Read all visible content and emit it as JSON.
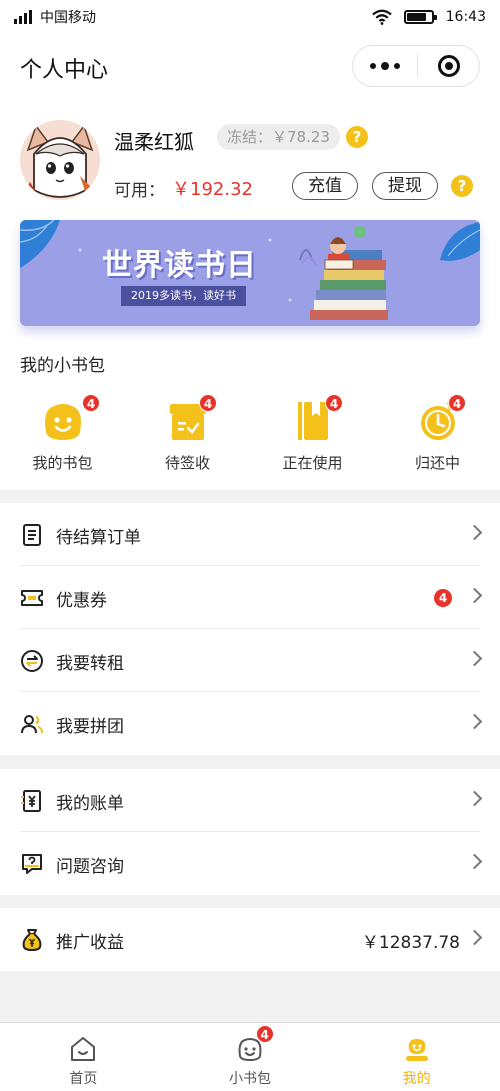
{
  "status_bar": {
    "carrier": "中国移动",
    "time": "16:43"
  },
  "nav": {
    "title": "个人中心"
  },
  "profile": {
    "username": "温柔红狐",
    "frozen": "冻结：￥78.23",
    "available_label": "可用：",
    "available_value": "￥192.32",
    "recharge_label": "充值",
    "withdraw_label": "提现",
    "help_glyph": "?"
  },
  "banner": {
    "title": "世界读书日",
    "subtitle": "2019多读书，读好书"
  },
  "bookbag": {
    "title": "我的小书包",
    "items": [
      {
        "label": "我的书包",
        "badge": "4",
        "icon": "smiley-bag-icon"
      },
      {
        "label": "待签收",
        "badge": "4",
        "icon": "package-icon"
      },
      {
        "label": "正在使用",
        "badge": "4",
        "icon": "book-bookmark-icon"
      },
      {
        "label": "归还中",
        "badge": "4",
        "icon": "clock-return-icon"
      }
    ]
  },
  "menu_group_1": [
    {
      "label": "待结算订单",
      "icon": "order-list-icon"
    },
    {
      "label": "优惠券",
      "icon": "coupon-icon",
      "badge": "4"
    },
    {
      "label": "我要转租",
      "icon": "transfer-icon"
    },
    {
      "label": "我要拼团",
      "icon": "group-users-icon"
    }
  ],
  "menu_group_2": [
    {
      "label": "我的账单",
      "icon": "bill-icon"
    },
    {
      "label": "问题咨询",
      "icon": "question-chat-icon"
    }
  ],
  "menu_group_3": [
    {
      "label": "推广收益",
      "icon": "money-bag-icon",
      "value": "￥12837.78"
    }
  ],
  "tab_bar": [
    {
      "label": "首页",
      "icon": "home-icon",
      "active": false
    },
    {
      "label": "小书包",
      "icon": "bookbag-tab-icon",
      "badge": "4",
      "active": false
    },
    {
      "label": "我的",
      "icon": "profile-tab-icon",
      "active": true
    }
  ],
  "colors": {
    "accent": "#F4C11A",
    "price_red": "#E8332A",
    "banner": "#9A9FE6",
    "active_tab": "#F0B400"
  }
}
